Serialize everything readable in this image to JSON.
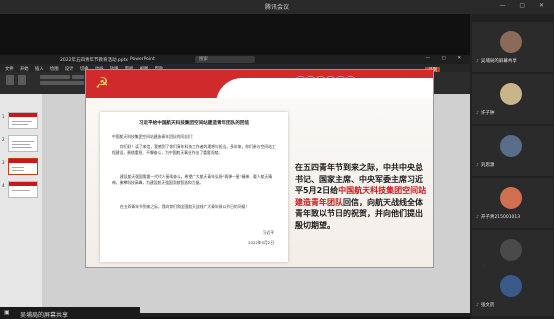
{
  "window": {
    "title": "腾讯会议"
  },
  "ppt": {
    "doc_name": "2022年五四青年节教育活动.pptx",
    "app_name": "PowerPoint",
    "search_placeholder": "搜索",
    "menu": [
      "文件",
      "开始",
      "插入",
      "绘图",
      "设计",
      "切换",
      "动画",
      "放映",
      "审阅",
      "视图",
      "帮助"
    ],
    "record": "录制",
    "slide_numbers": [
      "1",
      "2",
      "3",
      "4"
    ]
  },
  "slide": {
    "letter_title": "习近平给中国航天科技集团空间站建造青年团队的回信",
    "letter_greeting": "中国航天科技集团空间站建造青年团队的同志们：",
    "letter_p1": "你们好！读了来信，我感到了你们青年科技工作者的理想与担当。多年来，你们参与空间站工程建设，勇挑重担、不懈奋斗，为中国航天事业作出了重要贡献。",
    "letter_p2": "建设航天强国需要一代代人接续奋斗。希望广大航天青年弘扬“两弹一星”精神、载人航天精神，勇攀科技高峰，为建设航天强国贡献智慧和力量。",
    "letter_p3": "在五四青年节到来之际，我向你们和全国航天战线广大青年致以节日的问候！",
    "letter_sign": "习近平",
    "letter_date": "2022年5月2日",
    "side_text_1": "在五四青年节到来之际，中共中央总书记、国家主席、中央军委主席习近平5月2日给",
    "side_text_red": "中国航天科技集团空间站建造青年团队",
    "side_text_2": "回信，向航天战线全体青年致以节日的祝贺，并向他们提出殷切期望。"
  },
  "sharer": {
    "label": "吴埔局的屏幕共享"
  },
  "participants": [
    {
      "name": "吴埔局的屏幕共享",
      "avatar_color": "#8a6b5a"
    },
    {
      "name": "许子钟",
      "avatar_color": "#c9b58a"
    },
    {
      "name": "刘思源",
      "avatar_color": "#5a6e8a"
    },
    {
      "name": "开子青215001013",
      "avatar_color": "#d07050"
    },
    {
      "name": "曹耽烁",
      "avatar_color": "#4a4a4a"
    },
    {
      "name": "张文药",
      "avatar_color": "#3a5a8a"
    }
  ],
  "colors": {
    "party_red": "#c8181a",
    "header_red": "#d02a2c"
  }
}
